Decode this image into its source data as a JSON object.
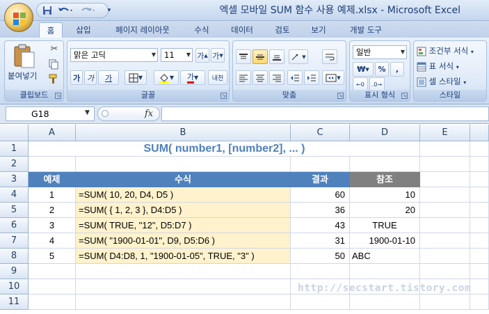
{
  "window": {
    "title": "엑셀 모바일 SUM 함수 사용 예제.xlsx - Microsoft Excel"
  },
  "qat": {
    "save_icon": "save-icon",
    "undo_icon": "undo-icon",
    "redo_icon": "redo-icon",
    "customize_icon": "customize-qat-icon"
  },
  "tabs": [
    {
      "label": "홈",
      "active": true
    },
    {
      "label": "삽입"
    },
    {
      "label": "페이지 레이아웃"
    },
    {
      "label": "수식"
    },
    {
      "label": "데이터"
    },
    {
      "label": "검토"
    },
    {
      "label": "보기"
    },
    {
      "label": "개발 도구"
    }
  ],
  "ribbon": {
    "clipboard": {
      "paste_label": "붙여넣기",
      "group_label": "클립보드"
    },
    "font": {
      "font_name": "맑은 고딕",
      "font_size": "11",
      "bold": "가",
      "italic": "가",
      "underline": "가",
      "font_color_glyph": "가",
      "phonetic": "내천",
      "group_label": "글꼴"
    },
    "alignment": {
      "group_label": "맞춤"
    },
    "number": {
      "format": "일반",
      "currency": "₩",
      "percent": "%",
      "comma": ",",
      "group_label": "표시 형식"
    },
    "styles": {
      "conditional": "조건부 서식",
      "table": "표 서식",
      "cell": "셀 스타일",
      "group_label": "스타일"
    }
  },
  "formula_bar": {
    "name_box": "G18",
    "fx": "fx",
    "content": ""
  },
  "columns": [
    "A",
    "B",
    "C",
    "D",
    "E"
  ],
  "rows": [
    "1",
    "2",
    "3",
    "4",
    "5",
    "6",
    "7",
    "8",
    "9",
    "10",
    "11"
  ],
  "sheet": {
    "title": "SUM( number1, [number2], ... )",
    "headers": {
      "example": "예제",
      "formula": "수식",
      "result": "결과",
      "reference": "참조"
    },
    "examples": [
      {
        "no": "1",
        "formula": "=SUM( 10, 20, D4, D5 )",
        "result": "60",
        "ref": "10"
      },
      {
        "no": "2",
        "formula": "=SUM( { 1, 2, 3 }, D4:D5 )",
        "result": "36",
        "ref": "20"
      },
      {
        "no": "3",
        "formula": "=SUM( TRUE, \"12\", D5:D7 )",
        "result": "43",
        "ref": "TRUE"
      },
      {
        "no": "4",
        "formula": "=SUM( \"1900-01-01\", D9, D5:D6 )",
        "result": "31",
        "ref": "1900-01-10"
      },
      {
        "no": "5",
        "formula": "=SUM( D4:D8, 1, \"1900-01-05\", TRUE, \"3\" )",
        "result": "50",
        "ref": "ABC"
      }
    ]
  },
  "watermark": "http://secstart.tistory.com",
  "colors": {
    "header_blue": "#4f81bd",
    "header_gray": "#808080",
    "formula_fill": "#fff2cc"
  }
}
